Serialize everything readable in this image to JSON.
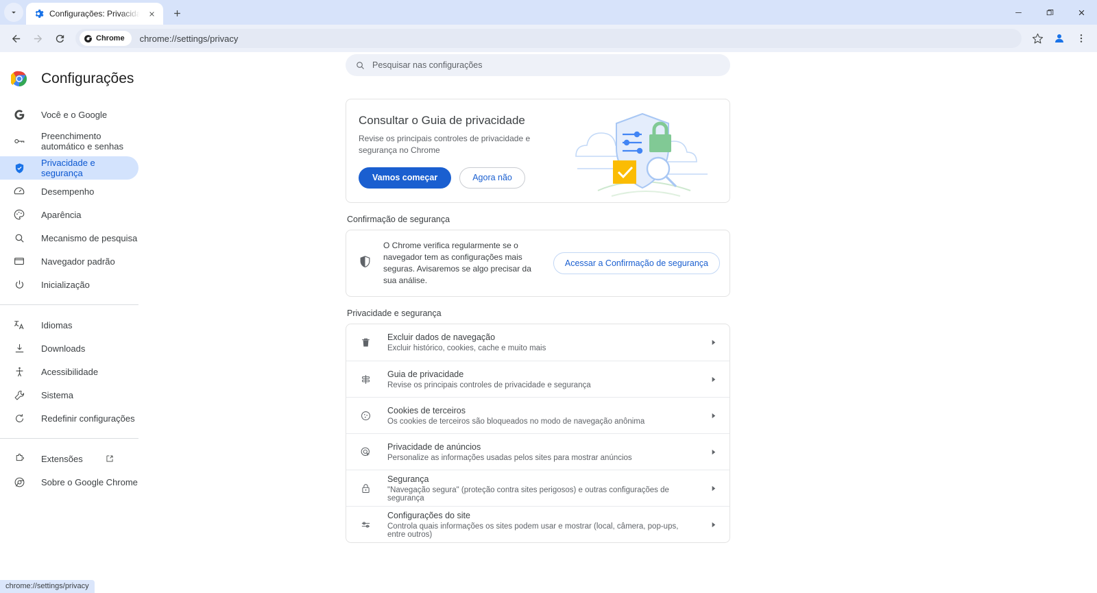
{
  "window": {
    "tab_search_label": "tab-search",
    "tab": {
      "title": "Configurações: Privacidade e se",
      "favicon": "settings-gear-icon"
    },
    "new_tab_label": "+",
    "controls": {
      "minimize": "–",
      "maximize": "❐",
      "close": "✕"
    }
  },
  "toolbar": {
    "back": "back-arrow",
    "forward": "forward-arrow",
    "reload": "reload-icon",
    "chip_label": "Chrome",
    "url": "chrome://settings/privacy",
    "bookmark": "star-icon",
    "profile": "profile-avatar",
    "menu": "three-dot-menu"
  },
  "sidebar": {
    "title": "Configurações",
    "items": [
      {
        "label": "Você e o Google",
        "icon": "google-g-icon",
        "active": false
      },
      {
        "label": "Preenchimento automático e senhas",
        "icon": "key-icon",
        "active": false,
        "tall": true
      },
      {
        "label": "Privacidade e segurança",
        "icon": "shield-icon",
        "active": true
      },
      {
        "label": "Desempenho",
        "icon": "speedometer-icon",
        "active": false
      },
      {
        "label": "Aparência",
        "icon": "palette-icon",
        "active": false
      },
      {
        "label": "Mecanismo de pesquisa",
        "icon": "search-icon",
        "active": false
      },
      {
        "label": "Navegador padrão",
        "icon": "window-icon",
        "active": false
      },
      {
        "label": "Inicialização",
        "icon": "power-icon",
        "active": false
      }
    ],
    "items2": [
      {
        "label": "Idiomas",
        "icon": "translate-icon"
      },
      {
        "label": "Downloads",
        "icon": "download-icon"
      },
      {
        "label": "Acessibilidade",
        "icon": "accessibility-icon"
      },
      {
        "label": "Sistema",
        "icon": "wrench-icon"
      },
      {
        "label": "Redefinir configurações",
        "icon": "restore-icon"
      }
    ],
    "items3": [
      {
        "label": "Extensões",
        "icon": "extension-puzzle-icon",
        "external": true
      },
      {
        "label": "Sobre o Google Chrome",
        "icon": "chrome-logo-icon",
        "external": false
      }
    ]
  },
  "search": {
    "placeholder": "Pesquisar nas configurações",
    "icon": "search-icon"
  },
  "privacy_guide_card": {
    "title": "Consultar o Guia de privacidade",
    "description": "Revise os principais controles de privacidade e segurança no Chrome",
    "primary_button": "Vamos começar",
    "secondary_button": "Agora não",
    "illustration": "privacy-shield-illustration"
  },
  "safety_check": {
    "heading": "Confirmação de segurança",
    "icon": "shield-half-icon",
    "description": "O Chrome verifica regularmente se o navegador tem as configurações mais seguras. Avisaremos se algo precisar da sua análise.",
    "button": "Acessar a Confirmação de segurança"
  },
  "privacy_section": {
    "heading": "Privacidade e segurança",
    "rows": [
      {
        "icon": "trash-icon",
        "title": "Excluir dados de navegação",
        "subtitle": "Excluir histórico, cookies, cache e muito mais"
      },
      {
        "icon": "guide-signpost-icon",
        "title": "Guia de privacidade",
        "subtitle": "Revise os principais controles de privacidade e segurança"
      },
      {
        "icon": "cookie-icon",
        "title": "Cookies de terceiros",
        "subtitle": "Os cookies de terceiros são bloqueados no modo de navegação anônima"
      },
      {
        "icon": "ad-target-icon",
        "title": "Privacidade de anúncios",
        "subtitle": "Personalize as informações usadas pelos sites para mostrar anúncios"
      },
      {
        "icon": "lock-icon",
        "title": "Segurança",
        "subtitle": "\"Navegação segura\" (proteção contra sites perigosos) e outras configurações de segurança"
      },
      {
        "icon": "sliders-icon",
        "title": "Configurações do site",
        "subtitle": "Controla quais informações os sites podem usar e mostrar (local, câmera, pop-ups, entre outros)"
      }
    ]
  },
  "status_bar": {
    "url": "chrome://settings/privacy"
  },
  "colors": {
    "tabstrip_bg": "#d7e3fa",
    "toolbar_bg": "#ecf0f9",
    "accent_blue": "#1a5fd0",
    "active_pill": "#d3e3fd",
    "active_text": "#0b57d0"
  }
}
